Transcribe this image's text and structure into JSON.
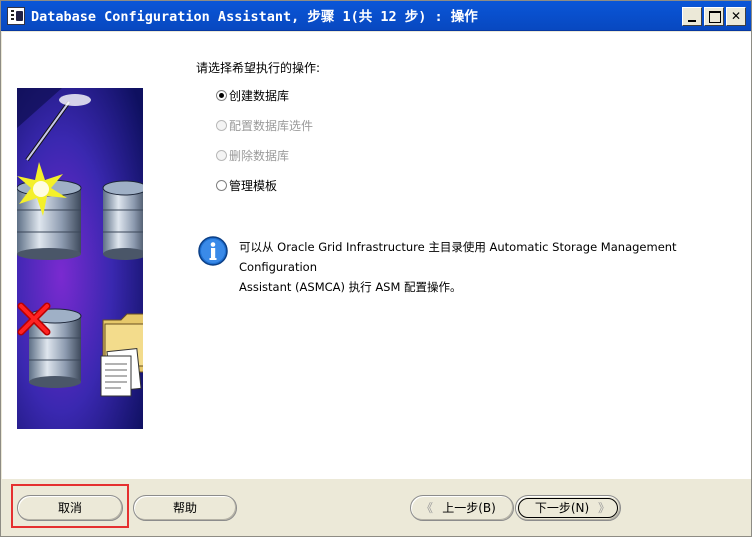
{
  "window": {
    "title": "Database Configuration Assistant, 步骤 1(共 12 步) : 操作"
  },
  "main": {
    "prompt": "请选择希望执行的操作:",
    "options": [
      {
        "label": "创建数据库",
        "selected": true,
        "enabled": true
      },
      {
        "label": "配置数据库选件",
        "selected": false,
        "enabled": false
      },
      {
        "label": "删除数据库",
        "selected": false,
        "enabled": false
      },
      {
        "label": "管理模板",
        "selected": false,
        "enabled": true
      }
    ],
    "info": {
      "icon": "info-icon",
      "line1": "可以从 Oracle Grid Infrastructure 主目录使用 Automatic Storage Management Configuration",
      "line2": "Assistant (ASMCA) 执行 ASM 配置操作。"
    }
  },
  "footer": {
    "cancel": "取消",
    "help": "帮助",
    "back": "上一步(B)",
    "next": "下一步(N)",
    "back_arrow": "《",
    "next_arrow": "》"
  },
  "colors": {
    "titlebar": "#0a56d8",
    "highlight": "#e53030",
    "art_background": "#1a1a6e"
  }
}
